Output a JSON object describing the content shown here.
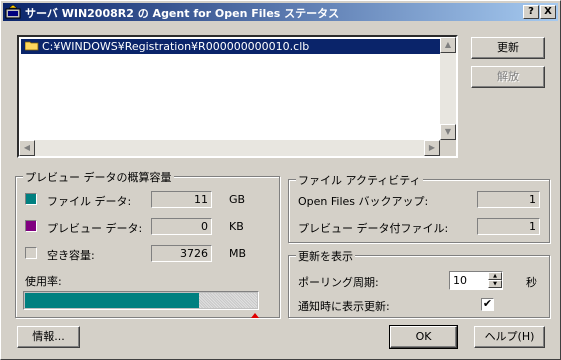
{
  "window": {
    "title": "サーバ WIN2008R2 の Agent for Open Files ステータス",
    "help_button": "?",
    "close_button": "X"
  },
  "file_list": {
    "items": [
      {
        "path": "C:¥WINDOWS¥Registration¥R000000000010.clb",
        "selected": true
      }
    ]
  },
  "side_buttons": {
    "refresh": "更新",
    "release": "解放"
  },
  "usage_group": {
    "title": "プレビュー データの概算容量",
    "rows": [
      {
        "label": "ファイル データ:",
        "value": "11",
        "unit": "GB",
        "color": "#008080"
      },
      {
        "label": "プレビュー データ:",
        "value": "0",
        "unit": "KB",
        "color": "#800080"
      },
      {
        "label": "空き容量:",
        "value": "3726",
        "unit": "MB",
        "color": "#d4d0c8"
      }
    ],
    "usage_label": "使用率:",
    "usage_fraction": 0.75
  },
  "activity_group": {
    "title": "ファイル アクティビティ",
    "rows": [
      {
        "label": "Open Files バックアップ:",
        "value": "1"
      },
      {
        "label": "プレビュー データ付ファイル:",
        "value": "1"
      }
    ]
  },
  "refresh_group": {
    "title": "更新を表示",
    "polling_label": "ポーリング周期:",
    "polling_value": "10",
    "polling_unit": "秒",
    "notify_label": "通知時に表示更新:",
    "notify_checked": true
  },
  "bottom_buttons": {
    "info": "情報...",
    "ok": "OK",
    "help": "ヘルプ(H)"
  }
}
